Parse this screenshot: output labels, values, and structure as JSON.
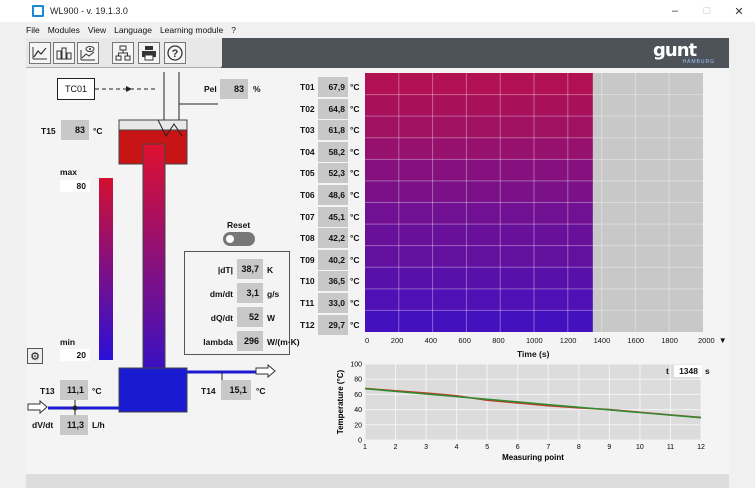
{
  "window": {
    "title": "WL900 - v. 19.1.3.0",
    "minimize": "–",
    "maximize": "□",
    "close": "✕"
  },
  "menu": [
    "File",
    "Modules",
    "View",
    "Language",
    "Learning module",
    "?"
  ],
  "logo": {
    "text": "gunt",
    "sub": "HAMBURG"
  },
  "schematic": {
    "tc_label": "TC01",
    "pel_label": "Pel",
    "pel_value": "83",
    "pel_unit": "%",
    "t15_label": "T15",
    "t15_value": "83",
    "t15_unit": "°C",
    "max_label": "max",
    "max_value": "80",
    "min_label": "min",
    "min_value": "20",
    "t13_label": "T13",
    "t13_value": "11,1",
    "t13_unit": "°C",
    "t14_label": "T14",
    "t14_value": "15,1",
    "t14_unit": "°C",
    "dvdt_label": "dV/dt",
    "dvdt_value": "11,3",
    "dvdt_unit": "L/h"
  },
  "reset": {
    "label": "Reset"
  },
  "calc": [
    {
      "label": "|dT|",
      "value": "38,7",
      "unit": "K"
    },
    {
      "label": "dm/dt",
      "value": "3,1",
      "unit": "g/s"
    },
    {
      "label": "dQ/dt",
      "value": "52",
      "unit": "W"
    },
    {
      "label": "lambda",
      "value": "296",
      "unit": "W/(m·K)"
    }
  ],
  "sensors": [
    {
      "label": "T01",
      "value": "67,9",
      "unit": "°C"
    },
    {
      "label": "T02",
      "value": "64,8",
      "unit": "°C"
    },
    {
      "label": "T03",
      "value": "61,8",
      "unit": "°C"
    },
    {
      "label": "T04",
      "value": "58,2",
      "unit": "°C"
    },
    {
      "label": "T05",
      "value": "52,3",
      "unit": "°C"
    },
    {
      "label": "T06",
      "value": "48,6",
      "unit": "°C"
    },
    {
      "label": "T07",
      "value": "45,1",
      "unit": "°C"
    },
    {
      "label": "T08",
      "value": "42,2",
      "unit": "°C"
    },
    {
      "label": "T09",
      "value": "40,2",
      "unit": "°C"
    },
    {
      "label": "T10",
      "value": "36,5",
      "unit": "°C"
    },
    {
      "label": "T11",
      "value": "33,0",
      "unit": "°C"
    },
    {
      "label": "T12",
      "value": "29,7",
      "unit": "°C"
    }
  ],
  "heatmap": {
    "xticks": [
      "0",
      "200",
      "400",
      "600",
      "800",
      "1000",
      "1200",
      "1400",
      "1600",
      "1800"
    ],
    "xmax": "2000",
    "xlabel": "Time (s)",
    "elapsed": 1348,
    "range": [
      0,
      2000
    ]
  },
  "time_readout": {
    "label": "t",
    "value": "1348",
    "unit": "s"
  },
  "chart_data": {
    "type": "line",
    "xlabel": "Measuring point",
    "ylabel": "Temperature (°C)",
    "xlim": [
      1,
      12
    ],
    "ylim": [
      0,
      100
    ],
    "x": [
      1,
      2,
      3,
      4,
      5,
      6,
      7,
      8,
      9,
      10,
      11,
      12
    ],
    "xticks": [
      "1",
      "2",
      "3",
      "4",
      "5",
      "6",
      "7",
      "8",
      "9",
      "10",
      "11",
      "12"
    ],
    "yticks": [
      "0",
      "20",
      "40",
      "60",
      "80",
      "100"
    ],
    "series": [
      {
        "color": "#c0392b",
        "values": [
          67.9,
          64.8,
          61.8,
          58.2,
          52.3,
          48.6,
          45.1,
          42.2,
          40.2,
          36.5,
          33.0,
          29.7
        ]
      },
      {
        "color": "#2e8b2e",
        "values": [
          67.5,
          64.0,
          60.5,
          57.0,
          53.6,
          50.1,
          46.6,
          43.1,
          39.6,
          36.1,
          32.7,
          29.2
        ]
      }
    ],
    "grid": true
  }
}
